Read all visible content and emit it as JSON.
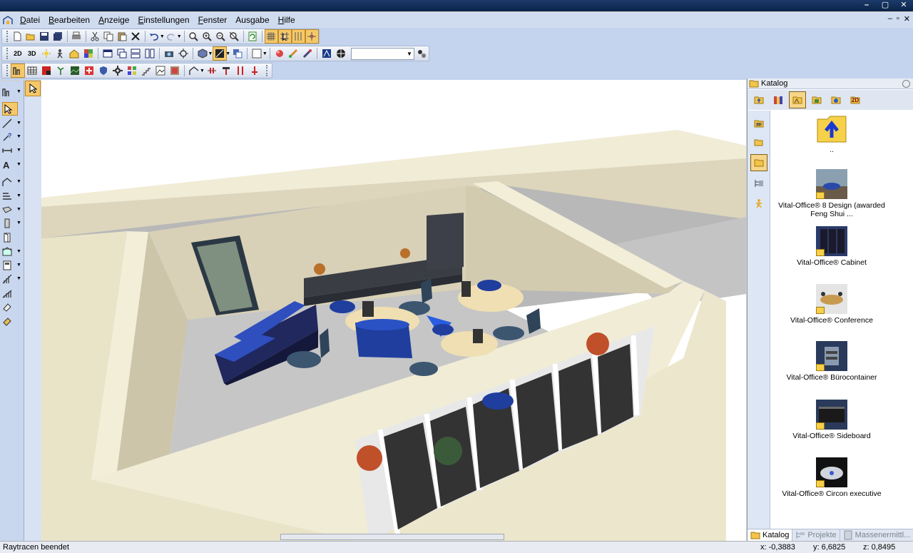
{
  "window": {
    "controls": [
      "–",
      "▢",
      "✕"
    ]
  },
  "menu": {
    "items": [
      {
        "key": "D",
        "rest": "atei"
      },
      {
        "key": "B",
        "rest": "earbeiten"
      },
      {
        "key": "A",
        "rest": "nzeige"
      },
      {
        "key": "E",
        "rest": "instellungen"
      },
      {
        "key": "F",
        "rest": "enster"
      },
      {
        "key": "",
        "rest": "Ausgabe"
      },
      {
        "key": "H",
        "rest": "ilfe"
      }
    ],
    "mdi_controls": [
      "–",
      "▫",
      "✕"
    ]
  },
  "toolbar2": {
    "label_2d": "2D",
    "label_3d": "3D",
    "combo_value": ""
  },
  "catalog": {
    "title": "Katalog",
    "label_2d": "2D",
    "items": [
      {
        "label": "..",
        "icon": "folder-up-icon"
      },
      {
        "label": "Vital-Office® 8 Design (awarded Feng Shui ...",
        "icon": "office-design-thumbnail"
      },
      {
        "label": "Vital-Office® Cabinet",
        "icon": "cabinet-thumbnail"
      },
      {
        "label": "Vital-Office®  Conference",
        "icon": "conference-thumbnail"
      },
      {
        "label": "Vital-Office® Bürocontainer",
        "icon": "container-thumbnail"
      },
      {
        "label": "Vital-Office®  Sideboard",
        "icon": "sideboard-thumbnail"
      },
      {
        "label": "Vital-Office® Circon executive",
        "icon": "circon-thumbnail"
      }
    ],
    "tabs": [
      {
        "label": "Katalog",
        "active": true
      },
      {
        "label": "Projekte",
        "active": false
      },
      {
        "label": "Massenermittl...",
        "active": false
      }
    ]
  },
  "status": {
    "message": "Raytracen beendet",
    "x": "x: -0,3883",
    "y": "y: 6,6825",
    "z": "z: 0,8495"
  },
  "colors": {
    "accent": "#f5c86a",
    "wall": "#efe9d2",
    "floor": "#c4c4c4",
    "furniture_blue": "#1f3e9e"
  }
}
